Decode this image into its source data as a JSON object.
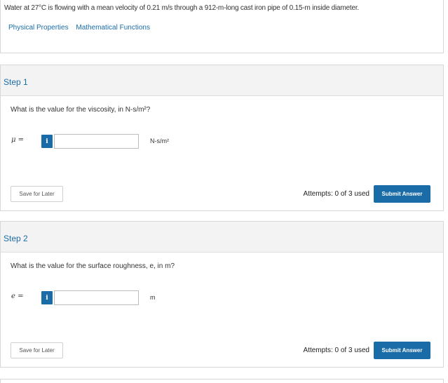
{
  "problem": {
    "text": "Water at 27°C is flowing with a mean velocity of 0.21 m/s through a 912-m-long cast iron pipe of 0.15-m inside diameter.",
    "links": [
      "Physical Properties",
      "Mathematical Functions"
    ]
  },
  "steps": [
    {
      "title": "Step 1",
      "question": "What is the value for the viscosity, in N-s/m²?",
      "symbol": "μ =",
      "info_label": "i",
      "input_value": "",
      "unit": "N-s/m²",
      "save_label": "Save for Later",
      "attempts": "Attempts: 0 of 3 used",
      "submit_label": "Submit Answer"
    },
    {
      "title": "Step 2",
      "question": "What is the value for the surface roughness, e, in m?",
      "symbol": "e =",
      "info_label": "i",
      "input_value": "",
      "unit": "m",
      "save_label": "Save for Later",
      "attempts": "Attempts: 0 of 3 used",
      "submit_label": "Submit Answer"
    }
  ],
  "colors": {
    "accent": "#1a6ca8",
    "header_bg": "#f3f3f3",
    "border": "#d8d8d8"
  }
}
